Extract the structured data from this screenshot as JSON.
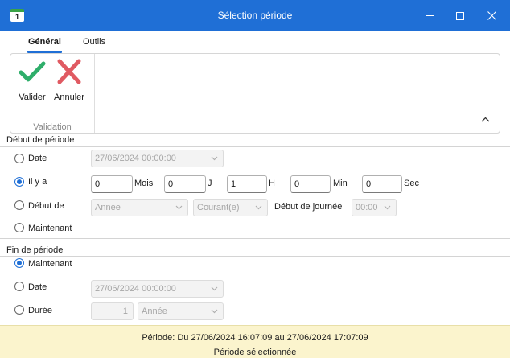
{
  "window": {
    "title": "Sélection période",
    "app_icon_text": "1"
  },
  "tabs": [
    {
      "label": "Général",
      "active": true
    },
    {
      "label": "Outils",
      "active": false
    }
  ],
  "ribbon": {
    "group_label": "Validation",
    "buttons": [
      {
        "label": "Valider",
        "icon": "checkmark-icon",
        "color": "#2eae6a"
      },
      {
        "label": "Annuler",
        "icon": "cross-icon",
        "color": "#e05a62"
      }
    ]
  },
  "start": {
    "title": "Début de période",
    "options": {
      "date": {
        "label": "Date",
        "checked": false,
        "value": "27/06/2024 00:00:00"
      },
      "ilya": {
        "label": "Il y a",
        "checked": true,
        "mois": {
          "value": "0",
          "unit": "Mois"
        },
        "jours": {
          "value": "0",
          "unit": "J"
        },
        "heures": {
          "value": "1",
          "unit": "H"
        },
        "minutes": {
          "value": "0",
          "unit": "Min"
        },
        "secondes": {
          "value": "0",
          "unit": "Sec"
        }
      },
      "debut_de": {
        "label": "Début de",
        "checked": false,
        "period": "Année",
        "mode": "Courant(e)",
        "day_start_label": "Début de journée",
        "day_start": "00:00"
      },
      "maintenant": {
        "label": "Maintenant",
        "checked": false
      }
    }
  },
  "end": {
    "title": "Fin de période",
    "options": {
      "maintenant": {
        "label": "Maintenant",
        "checked": true
      },
      "date": {
        "label": "Date",
        "checked": false,
        "value": "27/06/2024 00:00:00"
      },
      "duree": {
        "label": "Durée",
        "checked": false,
        "count": "1",
        "unit": "Année"
      }
    }
  },
  "footer": {
    "period_text": "Période: Du 27/06/2024 16:07:09 au 27/06/2024 17:07:09",
    "status_text": "Période sélectionnée"
  },
  "colors": {
    "titlebar": "#1f6fd6",
    "accent": "#1f6fd6",
    "footer_bg": "#fbf4cd"
  }
}
